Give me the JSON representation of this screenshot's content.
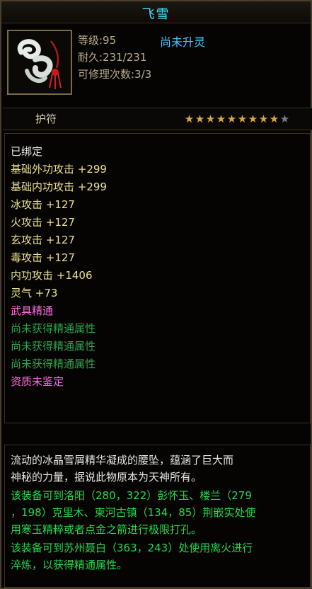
{
  "item": {
    "name": "飞雪",
    "level": "等级:95",
    "spirit_status": "尚未升灵",
    "durability": "耐久:231/231",
    "repairs": "可修理次数:3/3",
    "type": "护符",
    "stars_filled": 9,
    "stars_total": 10
  },
  "stats": {
    "bound": "已绑定",
    "lines": [
      {
        "text": "基础外功攻击 +299",
        "color": "y"
      },
      {
        "text": "基础内功攻击 +299",
        "color": "y"
      },
      {
        "text": "冰攻击 +127",
        "color": "y"
      },
      {
        "text": "火攻击 +127",
        "color": "y"
      },
      {
        "text": "玄攻击 +127",
        "color": "y"
      },
      {
        "text": "毒攻击 +127",
        "color": "y"
      },
      {
        "text": "内功攻击 +1406",
        "color": "y"
      },
      {
        "text": "灵气 +73",
        "color": "y"
      },
      {
        "text": "武具精通",
        "color": "p"
      },
      {
        "text": "尚未获得精通属性",
        "color": "gr"
      },
      {
        "text": "尚未获得精通属性",
        "color": "gr"
      },
      {
        "text": "尚未获得精通属性",
        "color": "gr"
      },
      {
        "text": "资质未鉴定",
        "color": "p"
      }
    ]
  },
  "description": {
    "lines": [
      {
        "text": "流动的冰晶雪屑精华凝成的腰坠，蕴涵了巨大而",
        "color": "w"
      },
      {
        "text": "神秘的力量，据说此物原本为天神所有。",
        "color": "w"
      },
      {
        "text": "该装备可到洛阳（280，322）彭怀玉、楼兰（279",
        "color": "g"
      },
      {
        "text": "，198）克里木、柬河古镇（134，85）荆嵌实处使",
        "color": "g"
      },
      {
        "text": "用寒玉精粹或者点金之箭进行极限打孔。",
        "color": "g"
      },
      {
        "text": "该装备可到苏州聂白（363，243）处使用离火进行",
        "color": "g"
      },
      {
        "text": "淬炼，以获得精通属性。",
        "color": "g"
      }
    ]
  },
  "colors": {
    "title": "#44e0ff",
    "star_filled": "#d8a640",
    "star_empty": "#7e7e7e"
  }
}
